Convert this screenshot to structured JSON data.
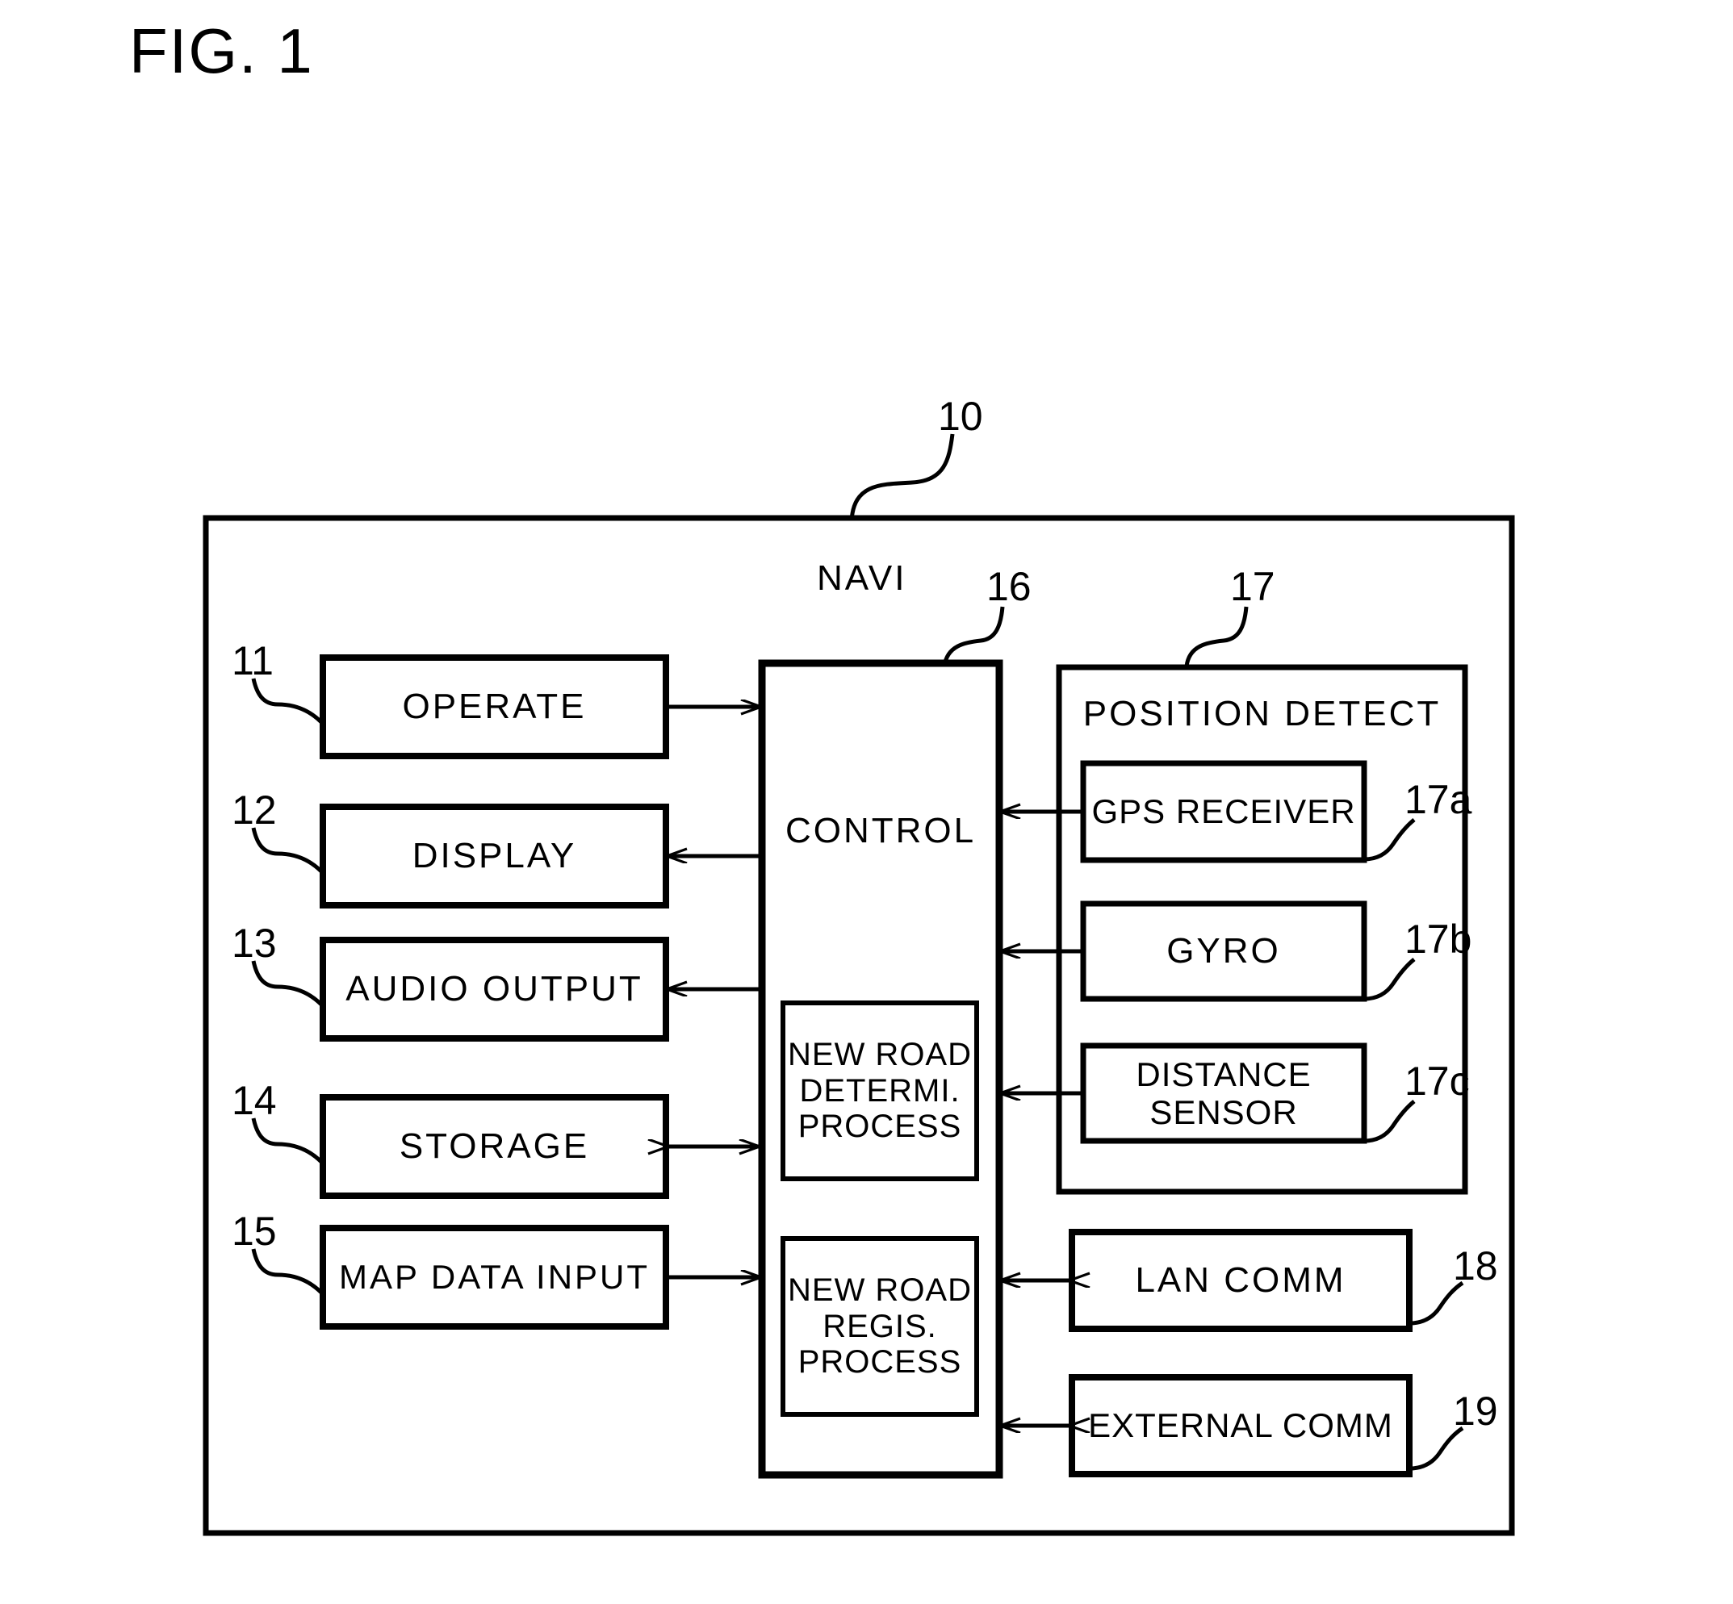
{
  "figure": {
    "title": "FIG. 1",
    "system_ref": "10",
    "navi_label": "NAVI"
  },
  "blocks": {
    "operate": {
      "label": "OPERATE",
      "ref": "11"
    },
    "display": {
      "label": "DISPLAY",
      "ref": "12"
    },
    "audio_output": {
      "label": "AUDIO OUTPUT",
      "ref": "13"
    },
    "storage": {
      "label": "STORAGE",
      "ref": "14"
    },
    "map_data_input": {
      "label": "MAP DATA INPUT",
      "ref": "15"
    },
    "control": {
      "label": "CONTROL",
      "ref": "16"
    },
    "new_road_determine": {
      "label": "NEW ROAD\nDETERMI.\nPROCESS"
    },
    "new_road_register": {
      "label": "NEW ROAD\nREGIS.\nPROCESS"
    },
    "position_detect": {
      "label": "POSITION DETECT",
      "ref": "17"
    },
    "gps_receiver": {
      "label": "GPS RECEIVER",
      "ref": "17a"
    },
    "gyro": {
      "label": "GYRO",
      "ref": "17b"
    },
    "distance_sensor": {
      "label": "DISTANCE\nSENSOR",
      "ref": "17c"
    },
    "lan_comm": {
      "label": "LAN COMM",
      "ref": "18"
    },
    "external_comm": {
      "label": "EXTERNAL COMM",
      "ref": "19"
    }
  },
  "connections": [
    {
      "name": "operate-to-control",
      "direction": "right"
    },
    {
      "name": "control-to-display",
      "direction": "left"
    },
    {
      "name": "control-to-audio-output",
      "direction": "left"
    },
    {
      "name": "storage-to-control",
      "direction": "both"
    },
    {
      "name": "map-data-input-to-control",
      "direction": "right"
    },
    {
      "name": "gps-receiver-to-control",
      "direction": "left"
    },
    {
      "name": "gyro-to-control",
      "direction": "left"
    },
    {
      "name": "distance-sensor-to-control",
      "direction": "left"
    },
    {
      "name": "lan-comm-to-control",
      "direction": "both"
    },
    {
      "name": "external-comm-to-control",
      "direction": "both"
    }
  ],
  "colors": {
    "ink": "#000000",
    "paper": "#ffffff"
  }
}
